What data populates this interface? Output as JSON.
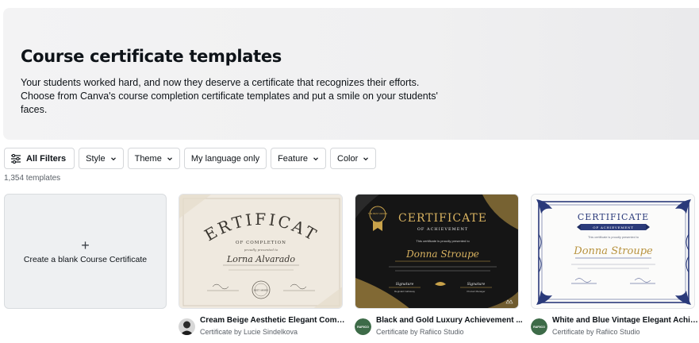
{
  "hero": {
    "title": "Course certificate templates",
    "description": "Your students worked hard, and now they deserve a certificate that recognizes their efforts. Choose from Canva's course completion certificate templates and put a smile on your students' faces."
  },
  "filters": {
    "all": "All Filters",
    "style": "Style",
    "theme": "Theme",
    "language": "My language only",
    "feature": "Feature",
    "color": "Color"
  },
  "count": "1,354 templates",
  "blank": {
    "plus": "+",
    "label": "Create a blank Course Certificate"
  },
  "cards": [
    {
      "title": "Cream Beige Aesthetic Elegant Compl...",
      "subtitle": "Certificate by Lucie Sindelkova",
      "thumb": {
        "heading": "CERTIFICATE",
        "tagline": "OF COMPLETION",
        "presented": "proudly presented to",
        "name": "Lorna Alvarado",
        "seal": "BEST AWARD"
      }
    },
    {
      "title": "Black and Gold Luxury Achievement ...",
      "subtitle": "Certificate by Rafiico Studio",
      "avatar_text": "RAFIICO",
      "thumb": {
        "badge": "THE BEST AWARD",
        "heading": "CERTIFICATE",
        "tagline": "OF ACHIEVEMENT",
        "presented": "This certificate is proudly presented to",
        "name": "Donna Stroupe",
        "sig1": "Signature",
        "sig2": "Signature",
        "sig1_name": "Reginald Cathaway",
        "sig2_name": "Product Manager"
      }
    },
    {
      "title": "White and Blue Vintage Elegant Achie...",
      "subtitle": "Certificate by Rafiico Studio",
      "avatar_text": "RAFIICO",
      "thumb": {
        "heading": "CERTIFICATE",
        "tagline": "OF ACHIEVEMENT",
        "presented": "This certificate is proudly presented to",
        "name": "Donna Stroupe"
      }
    }
  ],
  "colors": {
    "gold": "#c9a24a",
    "navy": "#2a3a7a",
    "cream": "#efe9df",
    "dark": "#151515"
  }
}
